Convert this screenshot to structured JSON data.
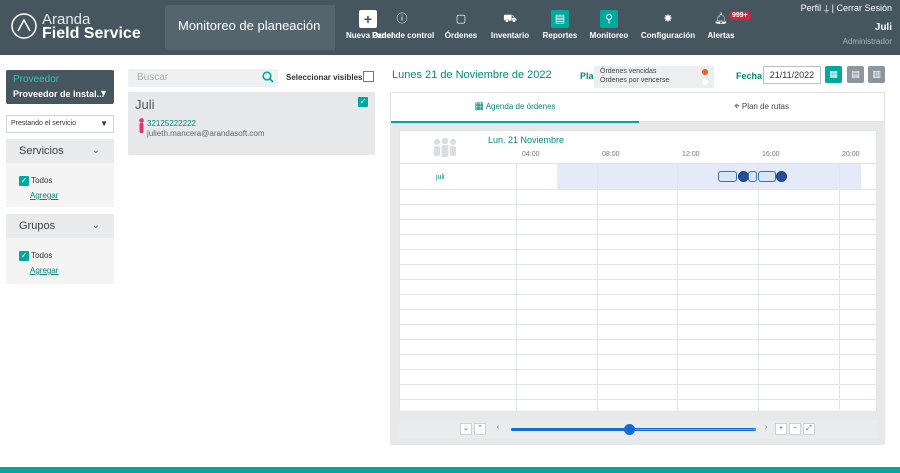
{
  "app": {
    "logo_line1": "Aranda",
    "logo_line2": "Field Service",
    "page_title": "Monitoreo de planeación"
  },
  "nav": [
    {
      "label": "Nueva Orden",
      "icon": "plus-icon"
    },
    {
      "label": "Panel de control",
      "icon": "info-icon"
    },
    {
      "label": "Órdenes",
      "icon": "orders-icon"
    },
    {
      "label": "Inventario",
      "icon": "cart-icon"
    },
    {
      "label": "Reportes",
      "icon": "report-icon"
    },
    {
      "label": "Monitoreo",
      "icon": "monitor-icon"
    },
    {
      "label": "Configuración",
      "icon": "gear-icon"
    },
    {
      "label": "Alertas",
      "icon": "bell-icon"
    }
  ],
  "alerts_badge": "999+",
  "user": {
    "profile_label": "Perfil",
    "separator": "|",
    "logout_label": "Cerrar Sesión",
    "name": "Juli",
    "role": "Administrador"
  },
  "filters": {
    "provider_label": "Proveedor",
    "provider_value": "Proveedor de Instal...",
    "state_value": "Prestando el servicio",
    "services": {
      "title": "Servicios",
      "all_label": "Todos",
      "add_label": "Agregar"
    },
    "groups": {
      "title": "Grupos",
      "all_label": "Todos",
      "add_label": "Agregar"
    }
  },
  "list": {
    "search_placeholder": "Buscar",
    "select_visible_label": "Seleccionar visibles",
    "items": [
      {
        "name": "Juli",
        "phone": "32125222222",
        "email": "julieth.mancera@arandasoft.com"
      }
    ]
  },
  "schedule": {
    "date_heading": "Lunes 21 de Noviembre de 2022",
    "plan_label": "Pla",
    "legend": [
      {
        "label": "Órdenes vencidas",
        "color": "#f15a24"
      },
      {
        "label": "Órdenes por vencerse",
        "color": "#ffffff"
      }
    ],
    "date_label": "Fecha",
    "date_value": "21/11/2022",
    "tabs": [
      {
        "label": "Agenda de órdenes"
      },
      {
        "label": "Plan de rutas"
      }
    ],
    "grid_date": "Lun. 21 Noviembre",
    "ticks": [
      "04:00",
      "08:00",
      "12:00",
      "16:00",
      "20:00"
    ],
    "rows": [
      {
        "label": "juli"
      }
    ]
  },
  "colors": {
    "accent": "#00a99d",
    "header": "#46565f",
    "link": "#00897b"
  }
}
